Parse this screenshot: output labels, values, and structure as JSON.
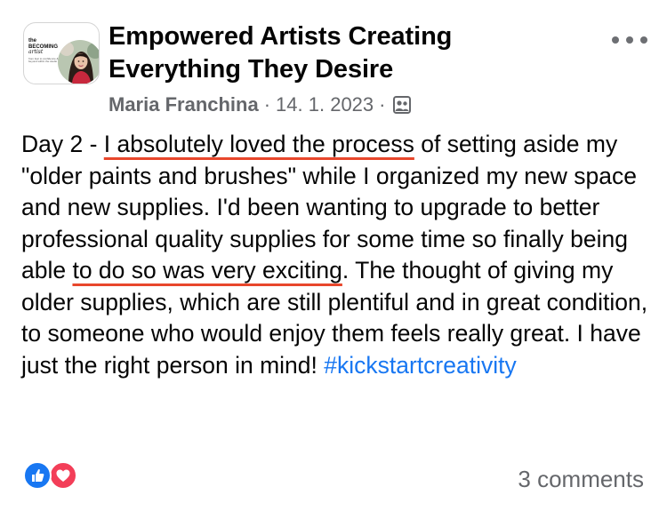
{
  "group": {
    "name": "Empowered Artists Creating Everything They Desire",
    "thumbnail": {
      "brand_line1": "the",
      "brand_line2": "BECOMING",
      "brand_line3": "artist",
      "tagline": "from fear to confidence & beyond within the studio"
    }
  },
  "post": {
    "author": "Maria Franchina",
    "separator": "·",
    "date": "14. 1. 2023",
    "audience_icon": "group-members-icon",
    "more_icon": "more-options-icon",
    "text": {
      "p1": "Day 2 - ",
      "u1": "I absolutely loved the process",
      "p2": " of setting aside my \"older paints and brushes\" while I organized my new space and new supplies.  I'd been wanting to upgrade to better professional quality supplies for some time so finally being able ",
      "u2": "to do so was very exciting",
      "p3": ".  The thought of giving my older supplies, which are still plentiful and in great condition, to someone who would enjoy them feels really great.  I have just the right person in mind! ",
      "hashtag": "#kickstartcreativity"
    }
  },
  "footer": {
    "reactions": [
      "like-reaction-icon",
      "love-reaction-icon"
    ],
    "comments_label": "3 comments"
  },
  "colors": {
    "primary_text": "#050505",
    "secondary_text": "#65676b",
    "link": "#1877f2",
    "underline_annotation": "#e8472c",
    "like": "#1877f2",
    "love": "#f33e58"
  }
}
